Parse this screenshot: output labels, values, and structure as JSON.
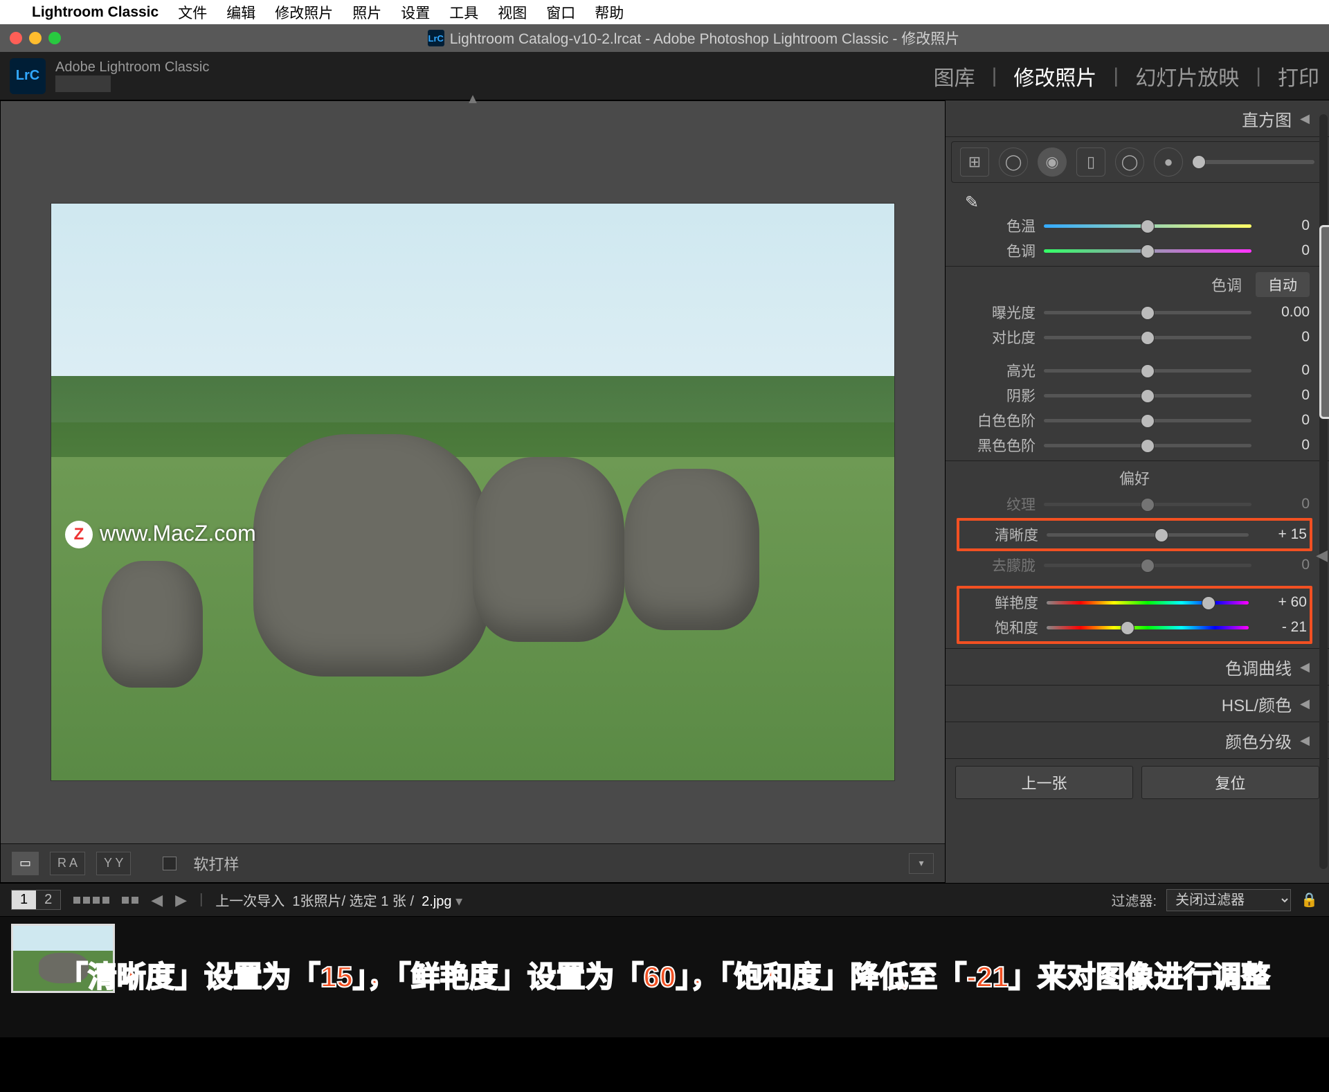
{
  "menubar": {
    "app": "Lightroom Classic",
    "items": [
      "文件",
      "编辑",
      "修改照片",
      "照片",
      "设置",
      "工具",
      "视图",
      "窗口",
      "帮助"
    ]
  },
  "window": {
    "lrc_badge": "LrC",
    "title": "Lightroom Catalog-v10-2.lrcat - Adobe Photoshop Lightroom Classic - 修改照片"
  },
  "header": {
    "brand": "Adobe Lightroom Classic",
    "modules": [
      "图库",
      "修改照片",
      "幻灯片放映",
      "打印"
    ],
    "active": "修改照片",
    "sep": "|"
  },
  "viewer": {
    "watermark_letter": "Z",
    "watermark_text": "www.MacZ.com",
    "toolbar": {
      "loupe": "▭",
      "ra": "R A",
      "yy": "Y Y",
      "softproof_label": "软打样"
    }
  },
  "panel": {
    "histogram": "直方图",
    "wb": {
      "temp_label": "色温",
      "temp_val": "0",
      "tint_label": "色调",
      "tint_val": "0"
    },
    "tone": {
      "title": "色调",
      "auto": "自动",
      "exposure_label": "曝光度",
      "exposure_val": "0.00",
      "contrast_label": "对比度",
      "contrast_val": "0",
      "highlights_label": "高光",
      "highlights_val": "0",
      "shadows_label": "阴影",
      "shadows_val": "0",
      "whites_label": "白色色阶",
      "whites_val": "0",
      "blacks_label": "黑色色阶",
      "blacks_val": "0"
    },
    "presence": {
      "title": "偏好",
      "texture_label": "纹理",
      "texture_val": "0",
      "clarity_label": "清晰度",
      "clarity_val": "+ 15",
      "clarity_pos": "57",
      "dehaze_label": "去朦胧",
      "dehaze_val": "0",
      "vibrance_label": "鲜艳度",
      "vibrance_val": "+ 60",
      "vibrance_pos": "80",
      "saturation_label": "饱和度",
      "saturation_val": "- 21",
      "saturation_pos": "40"
    },
    "sections": {
      "tonecurve": "色调曲线",
      "hsl": "HSL/颜色",
      "colorgrade": "颜色分级"
    },
    "nav": {
      "prev": "上一张",
      "reset": "复位"
    }
  },
  "infobar": {
    "seg1": "1",
    "seg2": "2",
    "crumb_prefix": "上一次导入",
    "crumb_count": "1张照片/ 选定 1 张 /",
    "crumb_file": "2.jpg",
    "filter_label": "过滤器:",
    "filter_value": "关闭过滤器"
  },
  "caption": "「清晰度」设置为「15」，「鲜艳度」设置为「60」，「饱和度」降低至「-21」来对图像进行调整"
}
